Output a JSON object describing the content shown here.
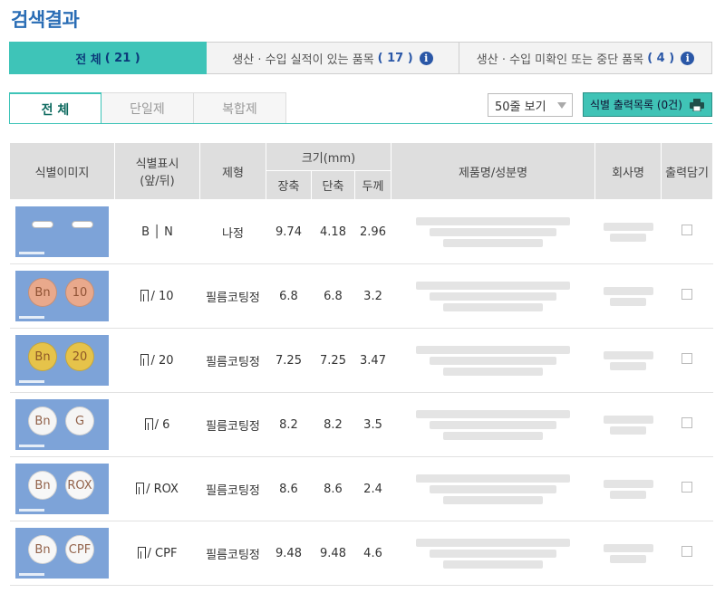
{
  "page_title": "검색결과",
  "big_tabs": [
    {
      "label": "전 체",
      "count": "( 21 )",
      "active": true,
      "info": false
    },
    {
      "label": "생산 · 수입 실적이 있는 품목",
      "count": "( 17 )",
      "active": false,
      "info": true
    },
    {
      "label": "생산 · 수입 미확인 또는 중단 품목",
      "count": "( 4 )",
      "active": false,
      "info": true
    }
  ],
  "sub_tabs": [
    "전 체",
    "단일제",
    "복합제"
  ],
  "page_size_select": {
    "value": "50줄 보기"
  },
  "print_button": {
    "label": "식별 출력목록 (0건)"
  },
  "table": {
    "headers": {
      "image": "식별이미지",
      "marking": "식별표시",
      "marking_sub": "(앞/뒤)",
      "form": "제형",
      "size": "크기(mm)",
      "long": "장축",
      "short": "단축",
      "thick": "두께",
      "product": "제품명/성분명",
      "company": "회사명",
      "print": "출력담기"
    },
    "rows": [
      {
        "marking": "B │ N",
        "form": "나정",
        "long": "9.74",
        "short": "4.18",
        "thick": "2.96",
        "pill_color": "#ffffff",
        "pill_text_l": "",
        "pill_text_r": "",
        "oblong": true
      },
      {
        "marking": "/ 10",
        "form": "필름코팅정",
        "long": "6.8",
        "short": "6.8",
        "thick": "3.2",
        "pill_color": "#e9a98c",
        "pill_text_l": "Bn",
        "pill_text_r": "10",
        "oblong": false
      },
      {
        "marking": "/ 20",
        "form": "필름코팅정",
        "long": "7.25",
        "short": "7.25",
        "thick": "3.47",
        "pill_color": "#e6c34a",
        "pill_text_l": "Bn",
        "pill_text_r": "20",
        "oblong": false
      },
      {
        "marking": "/ 6",
        "form": "필름코팅정",
        "long": "8.2",
        "short": "8.2",
        "thick": "3.5",
        "pill_color": "#f5f5f5",
        "pill_text_l": "Bn",
        "pill_text_r": "G",
        "oblong": false
      },
      {
        "marking": "/ ROX",
        "form": "필름코팅정",
        "long": "8.6",
        "short": "8.6",
        "thick": "2.4",
        "pill_color": "#f7f7f7",
        "pill_text_l": "Bn",
        "pill_text_r": "ROX",
        "oblong": false
      },
      {
        "marking": "/ CPF",
        "form": "필름코팅정",
        "long": "9.48",
        "short": "9.48",
        "thick": "4.6",
        "pill_color": "#f7f7f7",
        "pill_text_l": "Bn",
        "pill_text_r": "CPF",
        "oblong": false
      }
    ]
  },
  "colors": {
    "accent": "#3ec4b8",
    "title": "#2a6db5",
    "header_bg": "#dedede"
  }
}
